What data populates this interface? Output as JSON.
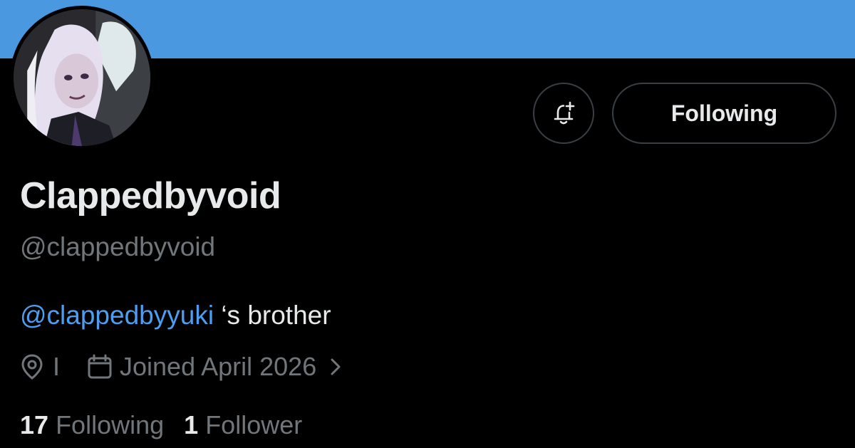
{
  "banner": {
    "color": "#4a98e0"
  },
  "avatar": {
    "icon": "profile-avatar-anime-character"
  },
  "actions": {
    "notify_icon": "bell-plus-icon",
    "follow_label": "Following"
  },
  "profile": {
    "display_name": "Clappedbyvoid",
    "handle": "@clappedbyvoid",
    "bio_mention": "@clappedbyyuki",
    "bio_text": " ‘s brother",
    "location": "I",
    "joined": "Joined April 2026"
  },
  "stats": {
    "following_count": "17",
    "following_label": "Following",
    "followers_count": "1",
    "followers_label": "Follower"
  },
  "colors": {
    "background": "#000000",
    "primary_text": "#e7e9ea",
    "secondary_text": "#71767b",
    "link": "#4c9ff0",
    "border": "#3a3f44"
  }
}
